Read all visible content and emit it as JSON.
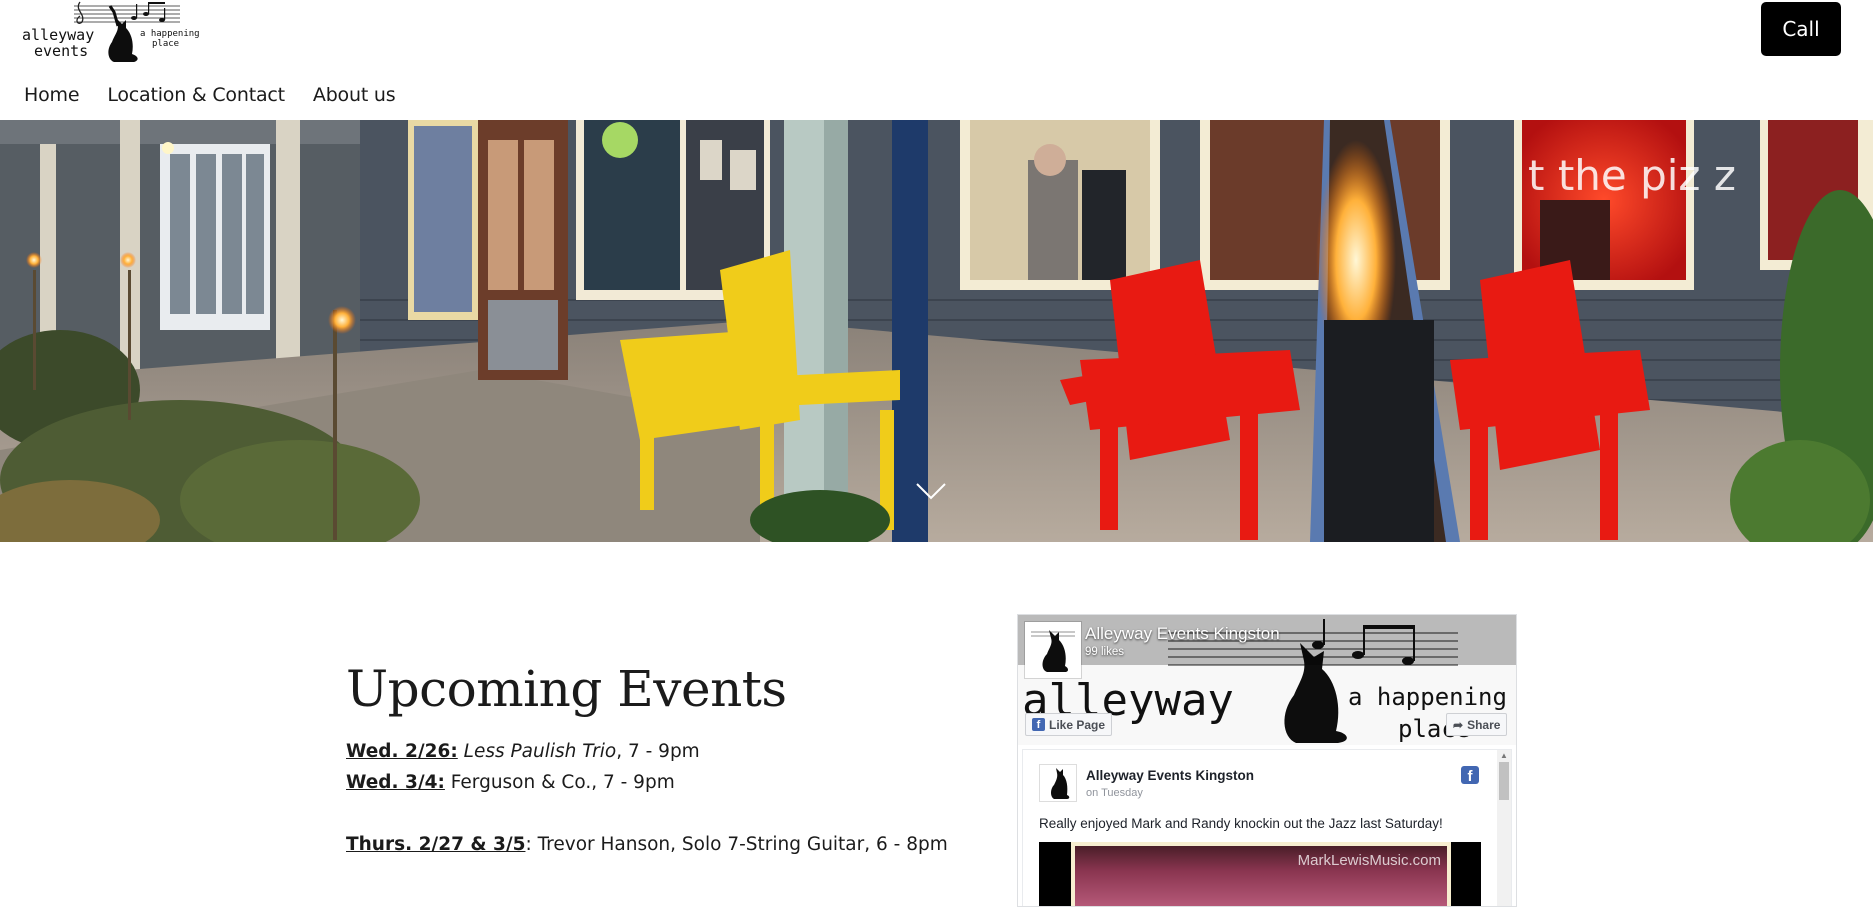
{
  "header": {
    "logo": {
      "alt": "alleyway events a happening place",
      "line1": "alleyway",
      "line2": "events",
      "tagline1": "a happening",
      "tagline2": "place"
    },
    "call_label": "Call",
    "nav": [
      {
        "label": "Home"
      },
      {
        "label": "Location & Contact"
      },
      {
        "label": "About us"
      }
    ]
  },
  "hero": {
    "sign_text": "t the piz z",
    "scroll_icon": "chevron-down-icon"
  },
  "events": {
    "title": "Upcoming Events",
    "items": [
      {
        "date": "Wed. 2/26:",
        "title": "Less Paulish Trio",
        "time": ", 7 - 9pm"
      },
      {
        "date": "Wed. 3/4:",
        "rest": " Ferguson & Co., 7 - 9pm"
      },
      {
        "date": "Thurs. 2/27 & 3/5",
        "rest": ": Trevor Hanson, Solo 7-String Guitar, 6 - 8pm"
      }
    ]
  },
  "facebook": {
    "page_name": "Alleyway Events Kingston",
    "likes": "99 likes",
    "like_button": "Like Page",
    "share_button": "Share",
    "cover_text1": "alleyway",
    "cover_text2": "a happening",
    "cover_text3": "place",
    "post": {
      "author": "Alleyway Events Kingston",
      "time": "on Tuesday",
      "text": "Really enjoyed Mark and Randy knockin out the Jazz last Saturday!",
      "image_watermark": "MarkLewisMusic.com"
    }
  },
  "colors": {
    "call_bg": "#000000",
    "fb_blue": "#4267b2",
    "text": "#1b1b1b"
  }
}
